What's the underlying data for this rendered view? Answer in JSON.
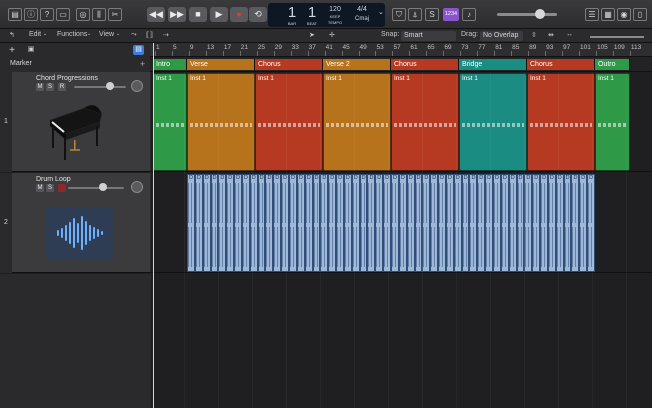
{
  "colors": {
    "intro": "#2e9a48",
    "verse": "#b7731b",
    "chorus": "#b63a22",
    "verse2": "#b7731b",
    "bridge": "#1a8c82",
    "outro": "#2e9a48",
    "audio_region": "#9fb8d8",
    "lcd_bg": "#0f1624"
  },
  "control_bar": {
    "lcd": {
      "bar_label": "BAR",
      "beat_label": "BEAT",
      "bar": "1",
      "beat": "1",
      "tempo": "120",
      "tempo_label": "KEEP",
      "tempo_sub": "TEMPO",
      "signature": "4/4",
      "key": "Cmaj"
    },
    "count_in": "1234"
  },
  "toolbar": {
    "edit": "Edit",
    "functions": "Functions",
    "view": "View",
    "snap_label": "Snap:",
    "snap_value": "Smart",
    "drag_label": "Drag:",
    "drag_value": "No Overlap"
  },
  "ruler": {
    "ticks": [
      "1",
      "5",
      "9",
      "13",
      "17",
      "21",
      "25",
      "29",
      "33",
      "37",
      "41",
      "45",
      "49",
      "53",
      "57",
      "61",
      "65",
      "69",
      "73",
      "77",
      "81",
      "85",
      "89",
      "93",
      "97",
      "101",
      "105",
      "109",
      "113"
    ]
  },
  "markers": {
    "header_label": "Marker",
    "items": [
      {
        "label": "Intro",
        "color": "#2e9a48"
      },
      {
        "label": "Verse",
        "color": "#b7731b"
      },
      {
        "label": "Chorus",
        "color": "#b63a22"
      },
      {
        "label": "Verse 2",
        "color": "#b7731b"
      },
      {
        "label": "Chorus",
        "color": "#b63a22"
      },
      {
        "label": "Bridge",
        "color": "#1a8c82"
      },
      {
        "label": "Chorus",
        "color": "#b63a22"
      },
      {
        "label": "Outro",
        "color": "#2e9a48"
      }
    ]
  },
  "tracks": [
    {
      "number": "1",
      "name": "Chord Progressions",
      "mute": "M",
      "solo": "S",
      "record": "R",
      "icon": "grand-piano-icon",
      "volume": 0.7,
      "regions": [
        {
          "label": "Inst 1",
          "color": "#2e9a48"
        },
        {
          "label": "Inst 1",
          "color": "#b7731b"
        },
        {
          "label": "Inst 1",
          "color": "#b63a22"
        },
        {
          "label": "Inst 1",
          "color": "#b7731b"
        },
        {
          "label": "Inst 1",
          "color": "#b63a22"
        },
        {
          "label": "Inst 1",
          "color": "#1a8c82"
        },
        {
          "label": "Inst 1",
          "color": "#b63a22"
        },
        {
          "label": "Inst 1",
          "color": "#2e9a48"
        }
      ]
    },
    {
      "number": "2",
      "name": "Drum Loop",
      "mute": "M",
      "solo": "S",
      "icon": "waveform-icon",
      "volume": 0.62,
      "audio_region_label": "D",
      "audio_region_count": 52
    }
  ]
}
